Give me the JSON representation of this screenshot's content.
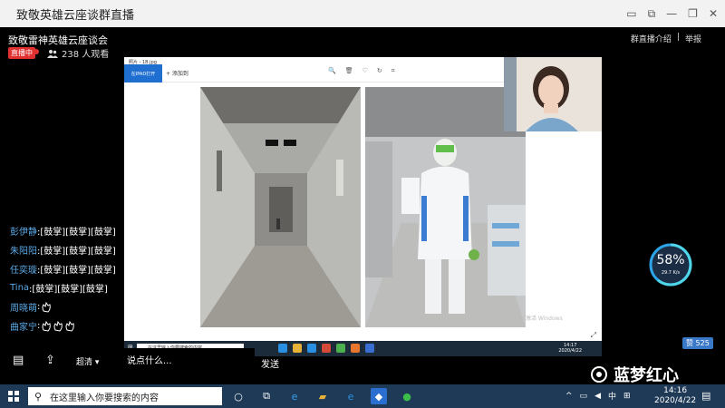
{
  "window": {
    "title": "致敬英雄云座谈群直播"
  },
  "stream": {
    "name": "致敬雷神英雄云座谈会",
    "live_badge": "直播中",
    "viewers": "238 人观看",
    "links": [
      "群直播介绍",
      "|",
      "举报"
    ]
  },
  "viewer_app": {
    "file_title": "照片 - 1B.jpg",
    "tab_label": "在IPAD打开",
    "add_label": "+ 添加到",
    "watermark": "激活 Windows",
    "taskbar_search": "在这里输入你要搜索的内容",
    "time": "14:17",
    "date": "2020/4/22"
  },
  "speed_widget": {
    "percent": "58%",
    "rate": "29.7 K/s"
  },
  "chat": [
    {
      "nick": "彭伊静",
      "text": ":[鼓掌][鼓掌][鼓掌]",
      "claps": 0
    },
    {
      "nick": "朱阳阳",
      "text": ":[鼓掌][鼓掌][鼓掌]",
      "claps": 0
    },
    {
      "nick": "任奕璇",
      "text": ":[鼓掌][鼓掌][鼓掌]",
      "claps": 0
    },
    {
      "nick": "Tina",
      "text": ":[鼓掌][鼓掌][鼓掌]",
      "claps": 0
    },
    {
      "nick": "周晓萌",
      "text": ":",
      "claps": 1
    },
    {
      "nick": "曲家宁",
      "text": ":",
      "claps": 3
    }
  ],
  "bottom_bar": {
    "clarity": "超清",
    "say_placeholder": "说点什么...",
    "send": "发送",
    "likes": "赞 525"
  },
  "overlay": {
    "brand": "蓝梦红心"
  },
  "taskbar": {
    "search_placeholder": "在这里输入你要搜索的内容",
    "ime": "中",
    "time": "14:16",
    "date": "2020/4/22"
  },
  "colors": {
    "live": "#e0302f",
    "nick": "#5aa9e6",
    "accent": "#1f6fd1",
    "taskbar": "#1e3a56"
  }
}
